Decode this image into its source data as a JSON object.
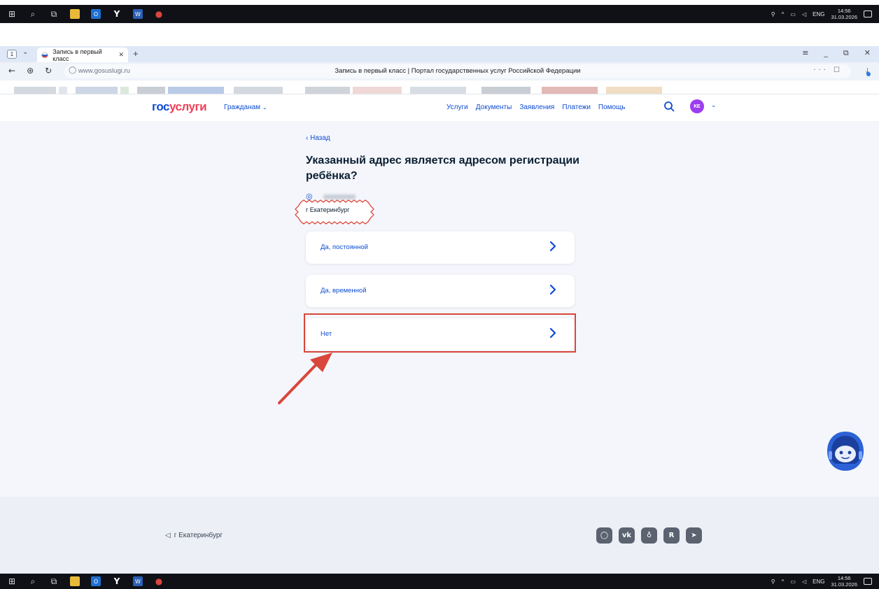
{
  "taskbar": {
    "lang": "ENG",
    "time": "14:56",
    "date": "31.03.2026"
  },
  "browser": {
    "tab_counter": "1",
    "tab_title": "Запись в первый класс",
    "url": "www.gosuslugi.ru",
    "page_title": "Запись в первый класс | Портал государственных услуг Российской Федерации"
  },
  "header": {
    "logo_part1": "гос",
    "logo_part2": "услуги",
    "citizens": "Гражданам",
    "nav": [
      "Услуги",
      "Документы",
      "Заявления",
      "Платежи",
      "Помощь"
    ],
    "avatar_initials": "КЕ"
  },
  "main": {
    "back": "Назад",
    "question": "Указанный адрес является адресом регистрации ребёнка?",
    "city": "г Екатеринбург",
    "options": [
      "Да, постоянной",
      "Да, временной",
      "Нет"
    ]
  },
  "footer": {
    "city": "г Екатеринбург"
  },
  "colors": {
    "brand_blue": "#0d4cd3",
    "brand_red": "#ee3f58",
    "annotation_red": "#d9463b"
  }
}
